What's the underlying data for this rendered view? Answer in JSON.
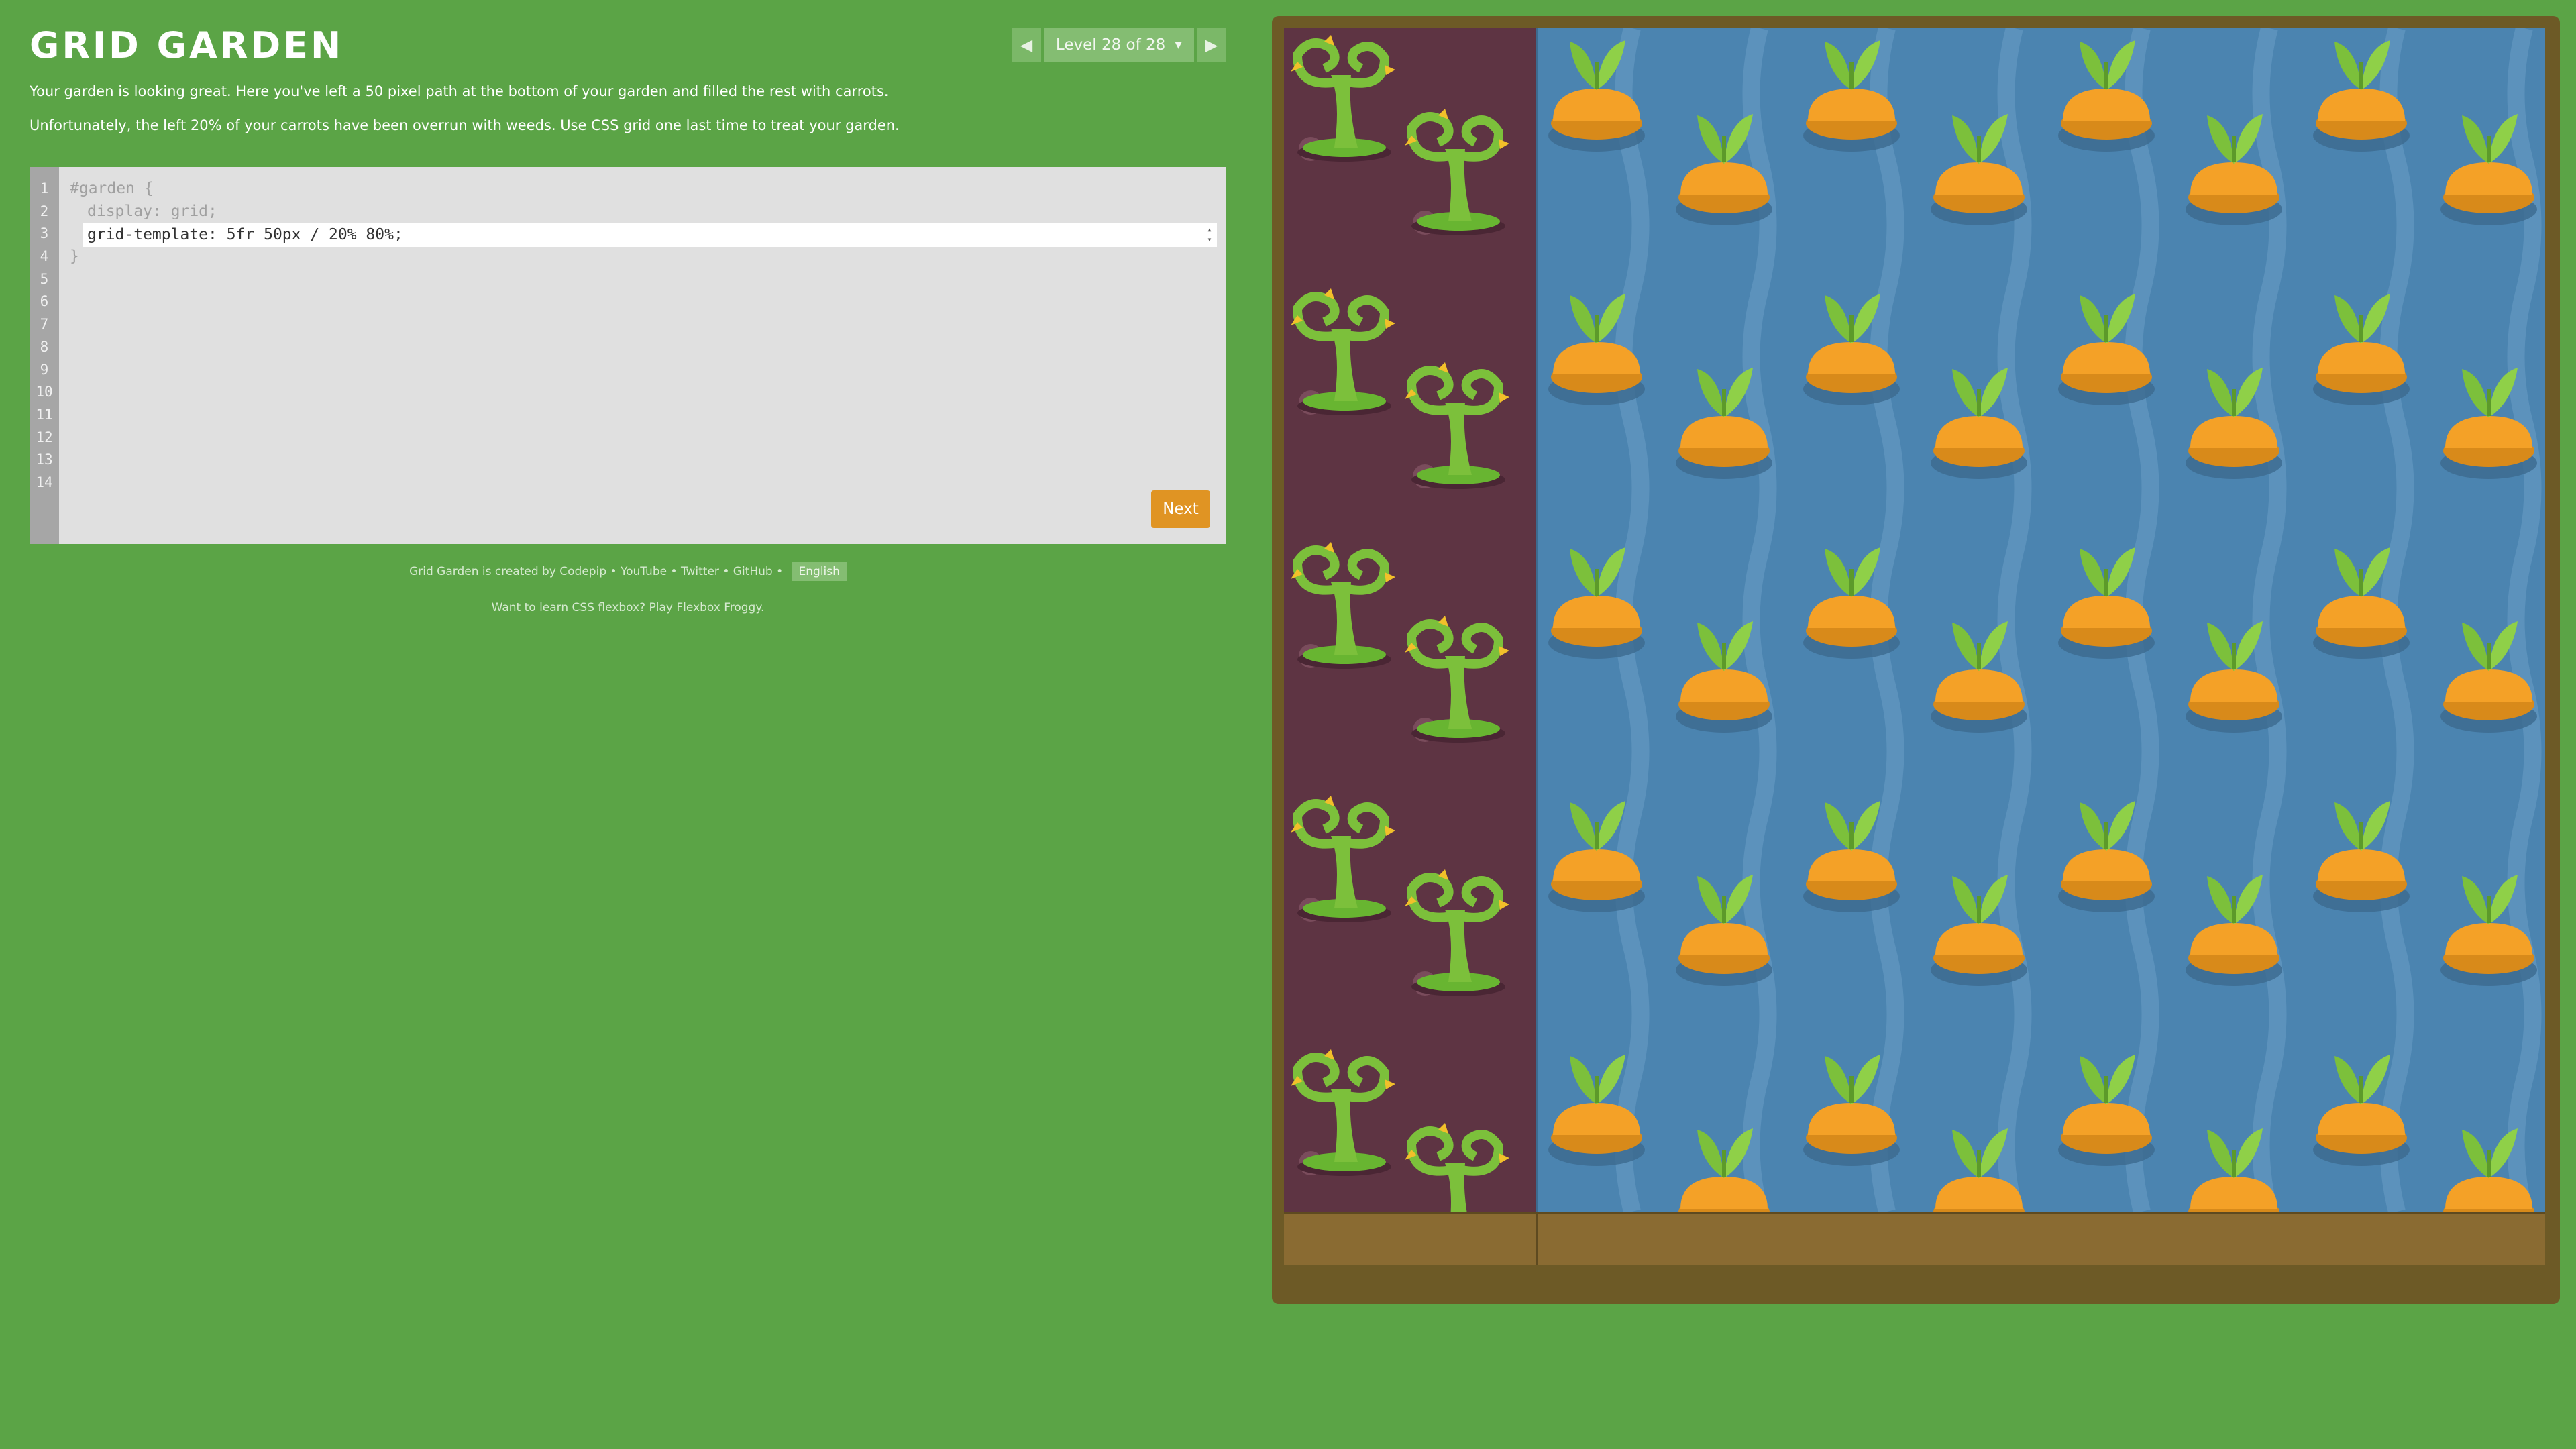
{
  "header": {
    "title": "GRID GARDEN",
    "level_label": "Level 28 of 28",
    "prev_icon": "triangle-left",
    "next_icon": "triangle-right"
  },
  "instructions": [
    "Your garden is looking great. Here you've left a 50 pixel path at the bottom of your garden and filled the rest with carrots.",
    "Unfortunately, the left 20% of your carrots have been overrun with weeds. Use CSS grid one last time to treat your garden."
  ],
  "editor": {
    "line_numbers": [
      "1",
      "2",
      "3",
      "4",
      "5",
      "6",
      "7",
      "8",
      "9",
      "10",
      "11",
      "12",
      "13",
      "14"
    ],
    "line1": "#garden {",
    "line2": "display: grid;",
    "input_value": "grid-template: 5fr 50px / 20% 80%;",
    "line4": "}",
    "next_label": "Next"
  },
  "footer": {
    "created_by": "Grid Garden is created by",
    "codepip": "Codepip",
    "sep": "•",
    "youtube": "YouTube",
    "twitter": "Twitter",
    "github": "GitHub",
    "language": "English",
    "promo_text": "Want to learn CSS flexbox? Play",
    "promo_link": "Flexbox Froggy",
    "promo_end": "."
  },
  "colors": {
    "background": "#5ba446",
    "weeds_bg": "#5e3443",
    "water_bg": "#4b84b0",
    "path": "#8a6b32",
    "carrot": "#f4a127",
    "leaf": "#7cc03b",
    "next_button": "#e09423"
  }
}
